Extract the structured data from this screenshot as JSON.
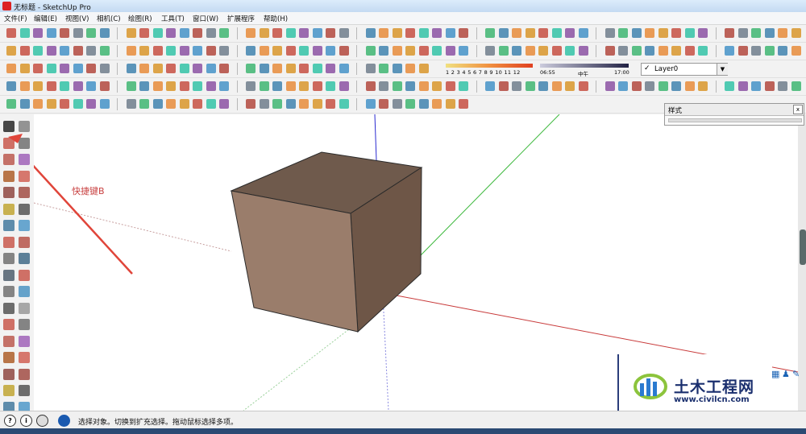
{
  "window": {
    "title": "无标题 - SketchUp Pro"
  },
  "menu": [
    {
      "label": "文件(F)"
    },
    {
      "label": "编辑(E)"
    },
    {
      "label": "视图(V)"
    },
    {
      "label": "相机(C)"
    },
    {
      "label": "绘图(R)"
    },
    {
      "label": "工具(T)"
    },
    {
      "label": "窗口(W)"
    },
    {
      "label": "扩展程序"
    },
    {
      "label": "帮助(H)"
    }
  ],
  "toolbar_shadow": {
    "months": "1 2 3 4 5 6 7 8 9 10 11 12",
    "time_start": "06:55",
    "time_mid": "中午",
    "time_end": "17:00"
  },
  "layer": {
    "check": "✓",
    "name": "Layer0",
    "dropdown": "▼"
  },
  "styles_panel": {
    "title": "样式",
    "close": "x"
  },
  "annotation": {
    "text": "快捷键B"
  },
  "status": {
    "text": "选择对象。切换到扩充选择。拖动鼠标选择多项。",
    "icon_info": "i",
    "icon_help": "?"
  },
  "watermark": {
    "title": "土木工程网",
    "url": "www.civilcn.com"
  },
  "colors": {
    "box_front": "#9a7d6b",
    "box_right": "#6e5647",
    "box_top": "#6f5a4c",
    "axis_red": "#c83a3a",
    "axis_green": "#3cb83c",
    "axis_blue": "#2a2ad0",
    "arrow": "#e0453a"
  }
}
